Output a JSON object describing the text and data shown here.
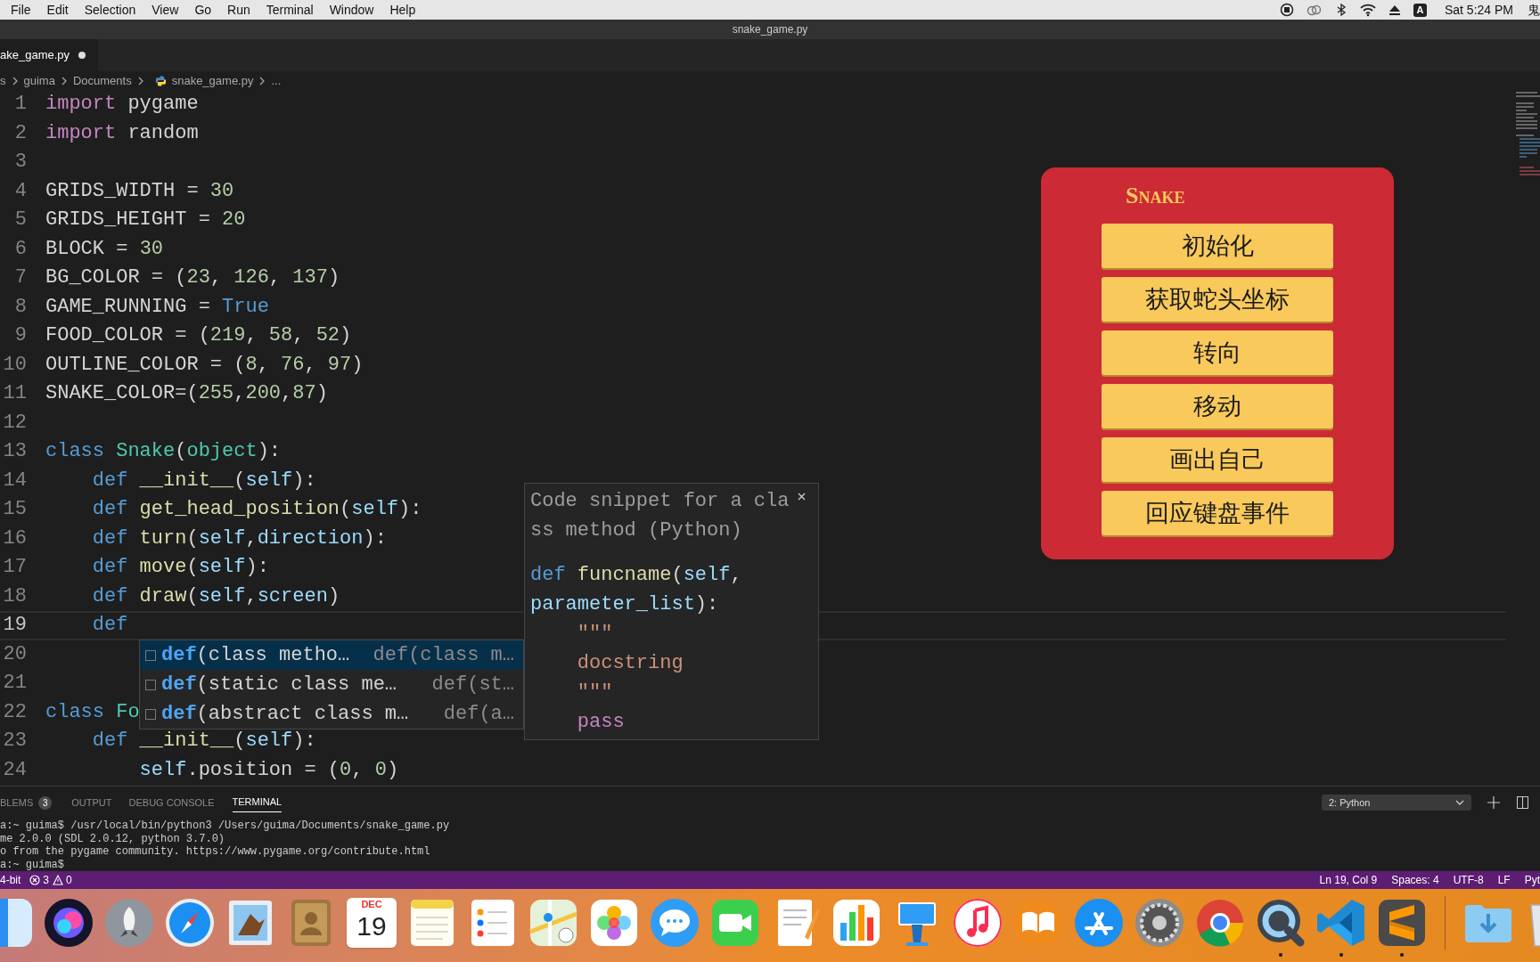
{
  "menu_bar": {
    "menus": [
      "File",
      "Edit",
      "Selection",
      "View",
      "Go",
      "Run",
      "Terminal",
      "Window",
      "Help"
    ],
    "input_source": "A",
    "clock": "Sat 5:24 PM",
    "user": "鬼"
  },
  "window": {
    "title": "snake_game.py"
  },
  "tabs": [
    {
      "label": "ake_game.py",
      "selected": true,
      "modified": true
    }
  ],
  "breadcrumb": [
    {
      "kind": "folder",
      "label": "s"
    },
    {
      "kind": "folder",
      "label": "guima"
    },
    {
      "kind": "folder",
      "label": "Documents"
    },
    {
      "kind": "file",
      "label": "snake_game.py"
    },
    {
      "kind": "folder",
      "label": "..."
    }
  ],
  "editor": {
    "lines": [
      {
        "number": "1",
        "current": false,
        "tokens": [
          {
            "text": "import",
            "kind": "keyword"
          },
          {
            "text": " pygame",
            "kind": "plain"
          }
        ]
      },
      {
        "number": "2",
        "current": false,
        "tokens": [
          {
            "text": "import",
            "kind": "keyword"
          },
          {
            "text": " random",
            "kind": "plain"
          }
        ]
      },
      {
        "number": "3",
        "current": false
      },
      {
        "number": "4",
        "current": false,
        "tokens": [
          {
            "text": "GRIDS_WIDTH = ",
            "kind": "plain"
          },
          {
            "text": "30",
            "kind": "number"
          }
        ]
      },
      {
        "number": "5",
        "current": false,
        "tokens": [
          {
            "text": "GRIDS_HEIGHT = ",
            "kind": "plain"
          },
          {
            "text": "20",
            "kind": "number"
          }
        ]
      },
      {
        "number": "6",
        "current": false,
        "tokens": [
          {
            "text": "BLOCK = ",
            "kind": "plain"
          },
          {
            "text": "30",
            "kind": "number"
          }
        ]
      },
      {
        "number": "7",
        "current": false,
        "tokens": [
          {
            "text": "BG_COLOR = (",
            "kind": "plain"
          },
          {
            "text": "23",
            "kind": "number"
          },
          {
            "text": ", ",
            "kind": "plain"
          },
          {
            "text": "126",
            "kind": "number"
          },
          {
            "text": ", ",
            "kind": "plain"
          },
          {
            "text": "137",
            "kind": "number"
          },
          {
            "text": ")",
            "kind": "plain"
          }
        ]
      },
      {
        "number": "8",
        "current": false,
        "tokens": [
          {
            "text": "GAME_RUNNING = ",
            "kind": "plain"
          },
          {
            "text": "True",
            "kind": "storage"
          }
        ]
      },
      {
        "number": "9",
        "current": false,
        "tokens": [
          {
            "text": "FOOD_COLOR = (",
            "kind": "plain"
          },
          {
            "text": "219",
            "kind": "number"
          },
          {
            "text": ", ",
            "kind": "plain"
          },
          {
            "text": "58",
            "kind": "number"
          },
          {
            "text": ", ",
            "kind": "plain"
          },
          {
            "text": "52",
            "kind": "number"
          },
          {
            "text": ")",
            "kind": "plain"
          }
        ]
      },
      {
        "number": "10",
        "current": false,
        "tokens": [
          {
            "text": "OUTLINE_COLOR = (",
            "kind": "plain"
          },
          {
            "text": "8",
            "kind": "number"
          },
          {
            "text": ", ",
            "kind": "plain"
          },
          {
            "text": "76",
            "kind": "number"
          },
          {
            "text": ", ",
            "kind": "plain"
          },
          {
            "text": "97",
            "kind": "number"
          },
          {
            "text": ")",
            "kind": "plain"
          }
        ]
      },
      {
        "number": "11",
        "current": false,
        "tokens": [
          {
            "text": "SNAKE_COLOR=(",
            "kind": "plain"
          },
          {
            "text": "255",
            "kind": "number"
          },
          {
            "text": ",",
            "kind": "plain"
          },
          {
            "text": "200",
            "kind": "number"
          },
          {
            "text": ",",
            "kind": "plain"
          },
          {
            "text": "87",
            "kind": "number"
          },
          {
            "text": ")",
            "kind": "plain"
          }
        ]
      },
      {
        "number": "12",
        "current": false
      },
      {
        "number": "13",
        "current": false,
        "tokens": [
          {
            "text": "class",
            "kind": "storage"
          },
          {
            "text": " Snake",
            "kind": "type"
          },
          {
            "text": "(",
            "kind": "plain"
          },
          {
            "text": "object",
            "kind": "type"
          },
          {
            "text": "):",
            "kind": "plain"
          }
        ]
      },
      {
        "number": "14",
        "current": false,
        "tokens": [
          {
            "text": "    def",
            "kind": "storage"
          },
          {
            "text": " __init__",
            "kind": "function"
          },
          {
            "text": "(",
            "kind": "plain"
          },
          {
            "text": "self",
            "kind": "param"
          },
          {
            "text": "):",
            "kind": "plain"
          }
        ]
      },
      {
        "number": "15",
        "current": false,
        "tokens": [
          {
            "text": "    def",
            "kind": "storage"
          },
          {
            "text": " get_head_position",
            "kind": "function"
          },
          {
            "text": "(",
            "kind": "plain"
          },
          {
            "text": "self",
            "kind": "param"
          },
          {
            "text": "):",
            "kind": "plain"
          }
        ]
      },
      {
        "number": "16",
        "current": false,
        "tokens": [
          {
            "text": "    def",
            "kind": "storage"
          },
          {
            "text": " turn",
            "kind": "function"
          },
          {
            "text": "(",
            "kind": "plain"
          },
          {
            "text": "self",
            "kind": "param"
          },
          {
            "text": ",",
            "kind": "plain"
          },
          {
            "text": "direction",
            "kind": "param"
          },
          {
            "text": "):",
            "kind": "plain"
          }
        ]
      },
      {
        "number": "17",
        "current": false,
        "tokens": [
          {
            "text": "    def",
            "kind": "storage"
          },
          {
            "text": " move",
            "kind": "function"
          },
          {
            "text": "(",
            "kind": "plain"
          },
          {
            "text": "self",
            "kind": "param"
          },
          {
            "text": "):",
            "kind": "plain"
          }
        ]
      },
      {
        "number": "18",
        "current": false,
        "tokens": [
          {
            "text": "    def",
            "kind": "storage"
          },
          {
            "text": " draw",
            "kind": "function"
          },
          {
            "text": "(",
            "kind": "plain"
          },
          {
            "text": "self",
            "kind": "param"
          },
          {
            "text": ",",
            "kind": "plain"
          },
          {
            "text": "screen",
            "kind": "param"
          },
          {
            "text": ")",
            "kind": "plain"
          }
        ]
      },
      {
        "number": "19",
        "current": true,
        "tokens": [
          {
            "text": "    def",
            "kind": "storage"
          }
        ]
      },
      {
        "number": "20",
        "current": false
      },
      {
        "number": "21",
        "current": false
      },
      {
        "number": "22",
        "current": false,
        "tokens": [
          {
            "text": "class",
            "kind": "storage"
          },
          {
            "text": " Fo",
            "kind": "type"
          }
        ]
      },
      {
        "number": "23",
        "current": false,
        "tokens": [
          {
            "text": "    def",
            "kind": "storage"
          },
          {
            "text": " __init__",
            "kind": "function"
          },
          {
            "text": "(",
            "kind": "plain"
          },
          {
            "text": "self",
            "kind": "param"
          },
          {
            "text": "):",
            "kind": "plain"
          }
        ]
      },
      {
        "number": "24",
        "current": false,
        "tokens": [
          {
            "text": "        self",
            "kind": "param"
          },
          {
            "text": ".position = (",
            "kind": "plain"
          },
          {
            "text": "0",
            "kind": "number"
          },
          {
            "text": ", ",
            "kind": "plain"
          },
          {
            "text": "0",
            "kind": "number"
          },
          {
            "text": ")",
            "kind": "plain"
          }
        ]
      }
    ]
  },
  "suggest": {
    "items": [
      {
        "label": "**def**(class metho…",
        "detail": "def(class m…",
        "selected": true
      },
      {
        "label": "**def**(static class me…",
        "detail": "def(st…",
        "selected": false
      },
      {
        "label": "**def**(abstract class m…",
        "detail": "def(a…",
        "selected": false
      }
    ],
    "details": {
      "header": [
        "Code snippet for a cla",
        "ss method (Python)"
      ],
      "code": [
        [
          {
            "text": "def",
            "kind": "storage"
          },
          {
            "text": " funcname",
            "kind": "function"
          },
          {
            "text": "(",
            "kind": "plain"
          },
          {
            "text": "self",
            "kind": "param"
          },
          {
            "text": ",",
            "kind": "plain"
          }
        ],
        [
          {
            "text": "parameter_list",
            "kind": "param"
          },
          {
            "text": "):",
            "kind": "plain"
          }
        ],
        [
          {
            "text": "    \"\"\"",
            "kind": "string"
          }
        ],
        [
          {
            "text": "    docstring",
            "kind": "string"
          }
        ],
        [
          {
            "text": "    \"\"\"",
            "kind": "string"
          }
        ],
        [
          {
            "text": "    pass",
            "kind": "keyword"
          }
        ]
      ]
    }
  },
  "snake_window": {
    "title": "Snake",
    "buttons": [
      "初始化",
      "获取蛇头坐标",
      "转向",
      "移动",
      "画出自己",
      "回应键盘事件"
    ]
  },
  "panel": {
    "tabs": [
      {
        "label": "BLEMS",
        "badge": "3",
        "selected": false
      },
      {
        "label": "OUTPUT",
        "selected": false
      },
      {
        "label": "DEBUG CONSOLE",
        "selected": false
      },
      {
        "label": "TERMINAL",
        "selected": true
      }
    ],
    "terminal_select": "2: Python",
    "lines": [
      "a:~ guima$ /usr/local/bin/python3 /Users/guima/Documents/snake_game.py",
      "me 2.0.0 (SDL 2.0.12, python 3.7.0)",
      "o from the pygame community. https://www.pygame.org/contribute.html",
      "a:~ guima$"
    ]
  },
  "status_bar": {
    "branch": "4-bit",
    "errors": "3",
    "warnings": "0",
    "items": [
      "Ln 19, Col 9",
      "Spaces: 4",
      "UTF-8",
      "LF",
      "Pyt"
    ]
  },
  "dock": {
    "items": [
      {
        "kind": "finder",
        "running": false
      },
      {
        "kind": "siri",
        "running": false
      },
      {
        "kind": "launchpad",
        "running": false
      },
      {
        "kind": "safari",
        "running": false
      },
      {
        "kind": "mail",
        "running": false
      },
      {
        "kind": "contacts",
        "running": false
      },
      {
        "kind": "calendar",
        "running": false,
        "month": "DEC",
        "day": "19"
      },
      {
        "kind": "notes",
        "running": false
      },
      {
        "kind": "reminders",
        "running": false
      },
      {
        "kind": "maps",
        "running": false
      },
      {
        "kind": "photos",
        "running": false
      },
      {
        "kind": "messages",
        "running": false
      },
      {
        "kind": "facetime",
        "running": false
      },
      {
        "kind": "pages",
        "running": false
      },
      {
        "kind": "numbers",
        "running": false
      },
      {
        "kind": "keynote",
        "running": false
      },
      {
        "kind": "music",
        "running": false
      },
      {
        "kind": "books",
        "running": false
      },
      {
        "kind": "appstore",
        "running": false
      },
      {
        "kind": "settings",
        "running": false
      },
      {
        "kind": "chrome",
        "running": false
      },
      {
        "kind": "quicktime",
        "running": true
      },
      {
        "kind": "vscode",
        "running": true
      },
      {
        "kind": "sublime",
        "running": true
      },
      {
        "kind": "divider"
      },
      {
        "kind": "downloads",
        "running": false
      },
      {
        "kind": "trash",
        "running": false
      }
    ]
  }
}
